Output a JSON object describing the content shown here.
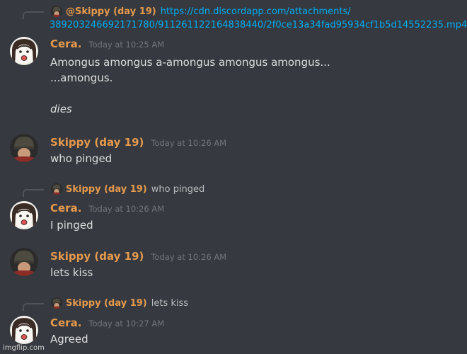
{
  "users": {
    "skippy": {
      "name": "Skippy (day 19)",
      "mention": "@Skippy (day 19)"
    },
    "cera": {
      "name": "Cera."
    }
  },
  "messages": [
    {
      "reply": {
        "author": "@Skippy (day 19)",
        "text": "https://cdn.discordapp.com/attachments/",
        "text2": "389203246692171780/911261122164838440/2f0ce13a34fad95934cf1b5d14552235.mp4"
      },
      "author": "Cera.",
      "timestamp": "Today at 10:25 AM",
      "lines": [
        "Amongus amongus a-amongus amongus amongus...",
        "...amongus.",
        "",
        "dies"
      ]
    },
    {
      "author": "Skippy (day 19)",
      "timestamp": "Today at 10:26 AM",
      "lines": [
        "who pinged"
      ]
    },
    {
      "reply": {
        "author": "Skippy (day 19)",
        "text": "who pinged"
      },
      "author": "Cera.",
      "timestamp": "Today at 10:26 AM",
      "lines": [
        "I pinged"
      ]
    },
    {
      "author": "Skippy (day 19)",
      "timestamp": "Today at 10:26 AM",
      "lines": [
        "lets kiss"
      ]
    },
    {
      "reply": {
        "author": "Skippy (day 19)",
        "text": "lets kiss"
      },
      "author": "Cera.",
      "timestamp": "Today at 10:27 AM",
      "lines": [
        "Agreed"
      ]
    }
  ],
  "watermark": "imgflip.com",
  "colors": {
    "background": "#36393f",
    "username": "#e59a4d",
    "link": "#00aff4",
    "text": "#dcddde",
    "timestamp": "#72767d"
  }
}
